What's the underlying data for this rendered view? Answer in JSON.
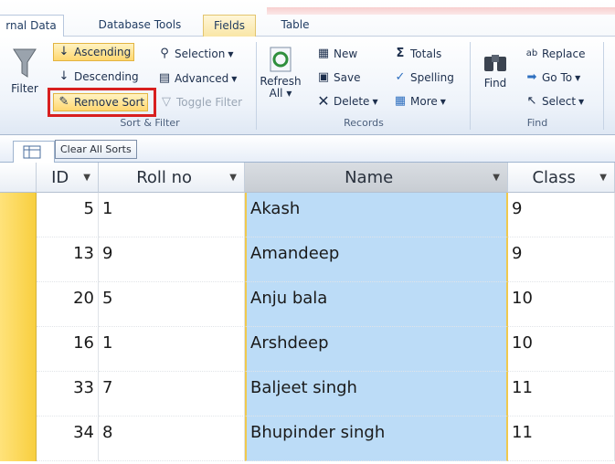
{
  "ribbon_tabs": [
    "rnal Data",
    "Database Tools",
    "Fields",
    "Table"
  ],
  "filter_button": "Filter",
  "sort_filter": {
    "ascending": "Ascending",
    "descending": "Descending",
    "remove_sort": "Remove Sort",
    "selection": "Selection",
    "advanced": "Advanced",
    "toggle_filter": "Toggle Filter",
    "group_label": "Sort & Filter"
  },
  "records": {
    "refresh_line1": "Refresh",
    "refresh_line2": "All",
    "new": "New",
    "save": "Save",
    "delete": "Delete",
    "totals": "Totals",
    "spelling": "Spelling",
    "more": "More",
    "group_label": "Records"
  },
  "find_group": {
    "find": "Find",
    "replace": "Replace",
    "goto": "Go To",
    "select": "Select",
    "group_label": "Find"
  },
  "tooltip": "Clear All Sorts",
  "columns": [
    "ID",
    "Roll no",
    "Name",
    "Class"
  ],
  "rows": [
    {
      "id": "5",
      "roll": "1",
      "name": "Akash",
      "class": "9"
    },
    {
      "id": "13",
      "roll": "9",
      "name": "Amandeep",
      "class": "9"
    },
    {
      "id": "20",
      "roll": "5",
      "name": "Anju bala",
      "class": "10"
    },
    {
      "id": "16",
      "roll": "1",
      "name": "Arshdeep",
      "class": "10"
    },
    {
      "id": "33",
      "roll": "7",
      "name": "Baljeet singh",
      "class": "11"
    },
    {
      "id": "34",
      "roll": "8",
      "name": "Bhupinder singh",
      "class": "11"
    }
  ]
}
